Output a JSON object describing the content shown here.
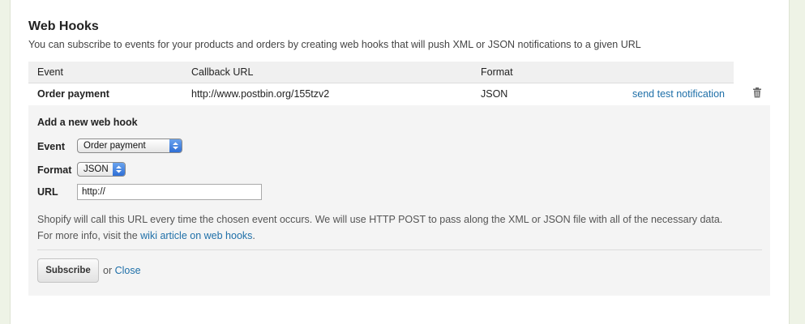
{
  "section": {
    "title": "Web Hooks",
    "subtitle": "You can subscribe to events for your products and orders by creating web hooks that will push XML or JSON notifications to a given URL"
  },
  "table": {
    "headers": [
      "Event",
      "Callback URL",
      "Format",
      ""
    ],
    "rows": [
      {
        "event": "Order payment",
        "callback_url": "http://www.postbin.org/155tzv2",
        "format": "JSON",
        "action_label": "send test notification",
        "delete_icon": "trash-icon"
      }
    ]
  },
  "add_form": {
    "title": "Add a new web hook",
    "event_label": "Event",
    "event_selected": "Order payment",
    "format_label": "Format",
    "format_selected": "JSON",
    "url_label": "URL",
    "url_value": "http://",
    "help_text_line1": "Shopify will call this URL every time the chosen event occurs. We will use HTTP POST to pass along the XML or JSON file with all of the necessary data.",
    "help_text_line2_prefix": "For more info, visit the",
    "help_link": "wiki article on web hooks",
    "help_text_line2_suffix": ".",
    "subscribe_label": "Subscribe",
    "or_text": "or",
    "close_label": "Close"
  },
  "colors": {
    "link": "#1e6fa8",
    "page_background": "#eef3e6",
    "form_background": "#f4f4f4"
  }
}
